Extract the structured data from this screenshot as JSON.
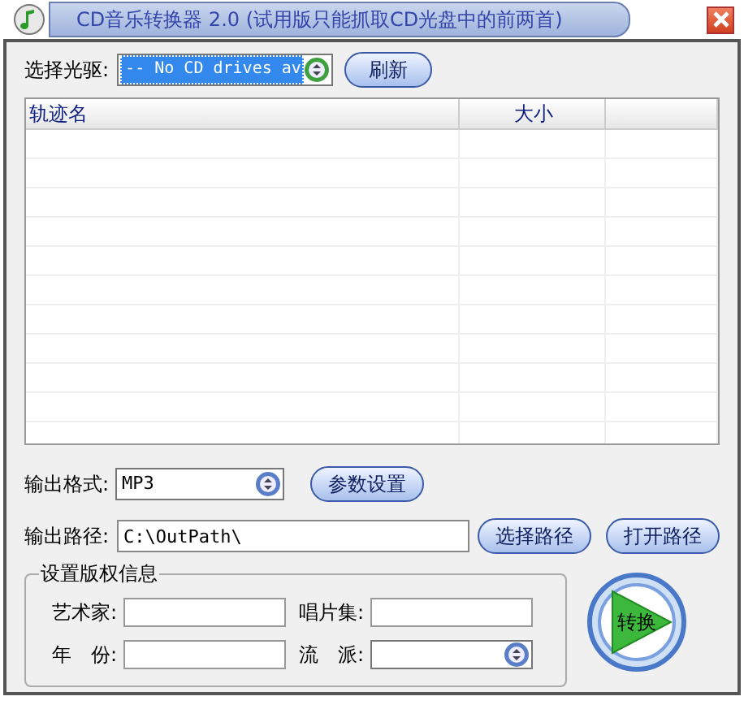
{
  "window": {
    "title": "CD音乐转换器 2.0 (试用版只能抓取CD光盘中的前两首)"
  },
  "drive": {
    "label": "选择光驱:",
    "value": "-- No CD drives av",
    "text_selected": true,
    "refresh_button": "刷新"
  },
  "table": {
    "columns": [
      "轨迹名",
      "大小"
    ]
  },
  "format": {
    "label": "输出格式:",
    "value": "MP3",
    "settings_button": "参数设置"
  },
  "path": {
    "label": "输出路径:",
    "value": "C:\\OutPath\\",
    "choose_button": "选择路径",
    "open_button": "打开路径"
  },
  "copyright": {
    "title": "设置版权信息",
    "fields": [
      {
        "label": "艺术家:",
        "kind": "text"
      },
      {
        "label": "唱片集:",
        "kind": "text"
      },
      {
        "label": "年　份:",
        "kind": "text"
      },
      {
        "label": "流　派:",
        "kind": "select"
      }
    ]
  },
  "convert_button": "转换"
}
